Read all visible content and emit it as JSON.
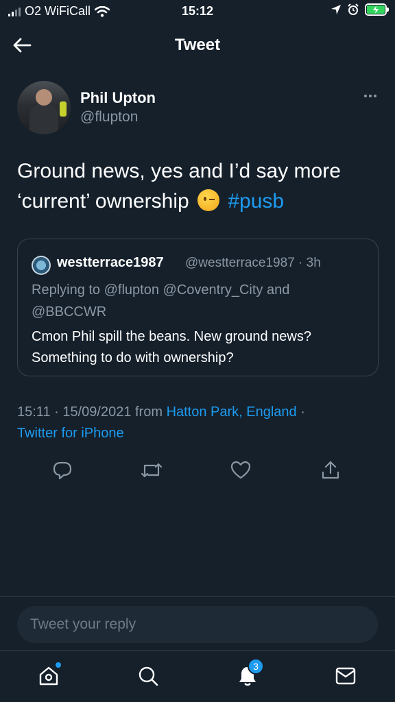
{
  "status_bar": {
    "carrier": "O2 WiFiCall",
    "time": "15:12"
  },
  "header": {
    "title": "Tweet"
  },
  "tweet": {
    "author_name": "Phil Upton",
    "author_handle": "@flupton",
    "text_line1": "Ground news, yes and I’d say more",
    "text_line2": "‘current’ ownership",
    "hashtag": "#pusb",
    "timestamp": "15:11 · 15/09/2021 from",
    "location": "Hatton Park, England",
    "separator": "·",
    "source": "Twitter for iPhone"
  },
  "quoted_tweet": {
    "author_name": "westterrace1987",
    "meta": "@westterrace1987 · 3h",
    "replying_to": "Replying to @flupton @Coventry_City and @BBCCWR",
    "text": "Cmon Phil spill the beans. New ground news? Something to do with ownership?"
  },
  "reply_box": {
    "placeholder": "Tweet your reply"
  },
  "tab_bar": {
    "notification_count": "3"
  },
  "colors": {
    "background": "#15202b",
    "accent": "#1d9bf0",
    "secondary_text": "#8b98a5"
  },
  "icons": [
    "signal-icon",
    "wifi-icon",
    "location-icon",
    "alarm-icon",
    "battery-icon",
    "back-arrow-icon",
    "more-icon",
    "wink-emoji-icon",
    "reply-icon",
    "retweet-icon",
    "like-icon",
    "share-icon",
    "home-icon",
    "search-icon",
    "notifications-icon",
    "messages-icon"
  ]
}
